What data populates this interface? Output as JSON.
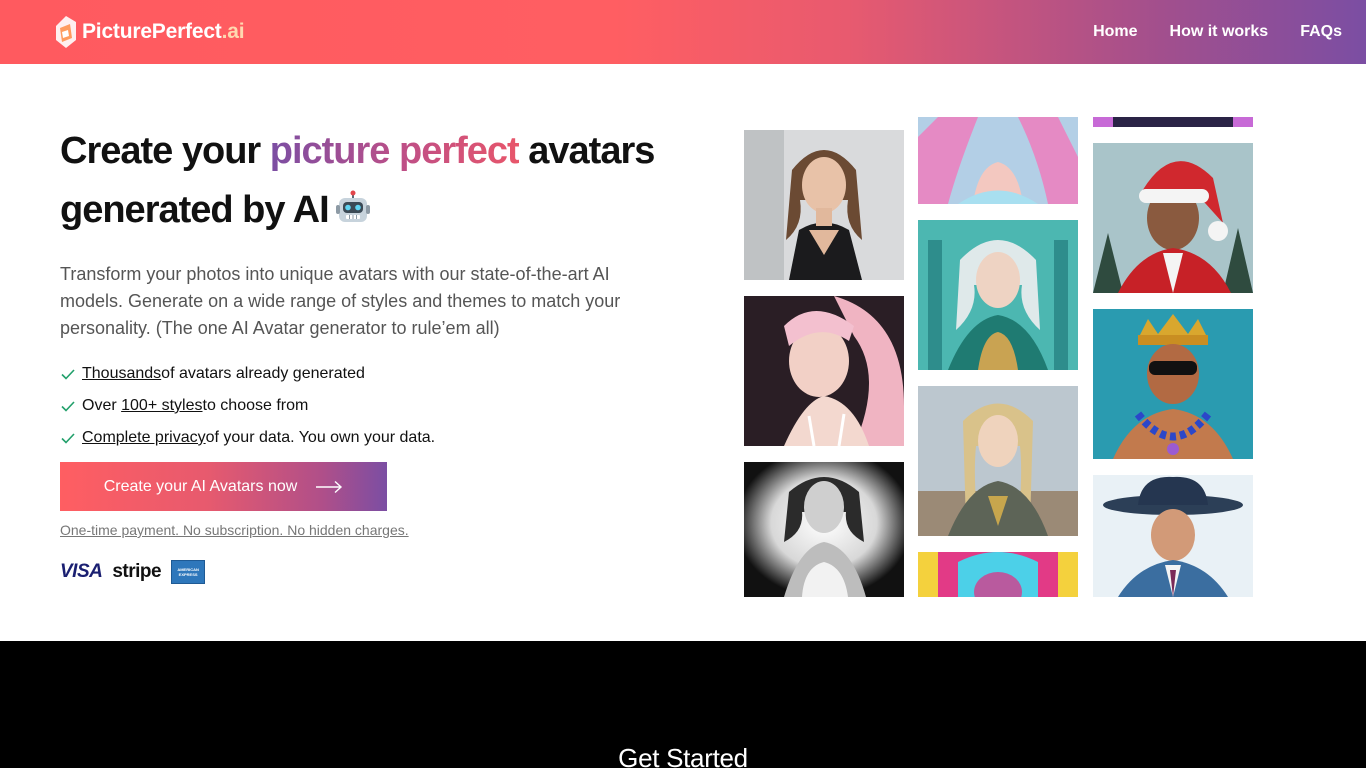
{
  "brand": {
    "name_main": "PicturePerfect",
    "name_suffix": ".ai"
  },
  "nav": {
    "items": [
      "Home",
      "How it works",
      "FAQs"
    ]
  },
  "hero": {
    "title_pre": "Create your ",
    "title_highlight": "picture perfect",
    "title_post": " avatars generated by AI",
    "robot_icon": "robot-emoji-icon",
    "description": "Transform your photos into unique avatars with our state-of-the-art AI models. Generate on a wide range of styles and themes to match your personality. (The one AI Avatar generator to rule’em all)",
    "features": [
      {
        "link": "Thousands",
        "pre": "",
        "post": " of avatars already generated"
      },
      {
        "link": "100+ styles",
        "pre": "Over ",
        "post": " to choose from"
      },
      {
        "link": "Complete privacy",
        "pre": "",
        "post": " of your data. You own your data."
      }
    ],
    "cta_label": "Create your AI Avatars now",
    "payment_note": "One-time payment. No subscription. No hidden charges.",
    "payments": {
      "visa": "VISA",
      "stripe": "stripe",
      "amex_line1": "AMERICAN",
      "amex_line2": "EXPRESS"
    }
  },
  "colors": {
    "accent_start": "#ff5e62",
    "accent_end": "#7b4ea3",
    "check": "#22a06b"
  },
  "gallery": {
    "tiles": [
      "portrait-businesswoman",
      "portrait-pastel-fantasy",
      "portrait-partial-top",
      "portrait-santa-hat",
      "portrait-pink-hair",
      "portrait-elf-queen",
      "portrait-king-crown",
      "portrait-black-white",
      "portrait-elf-warrior",
      "portrait-cowboy-hat",
      "portrait-rainbow-art"
    ]
  },
  "section2": {
    "title": "Get Started"
  }
}
